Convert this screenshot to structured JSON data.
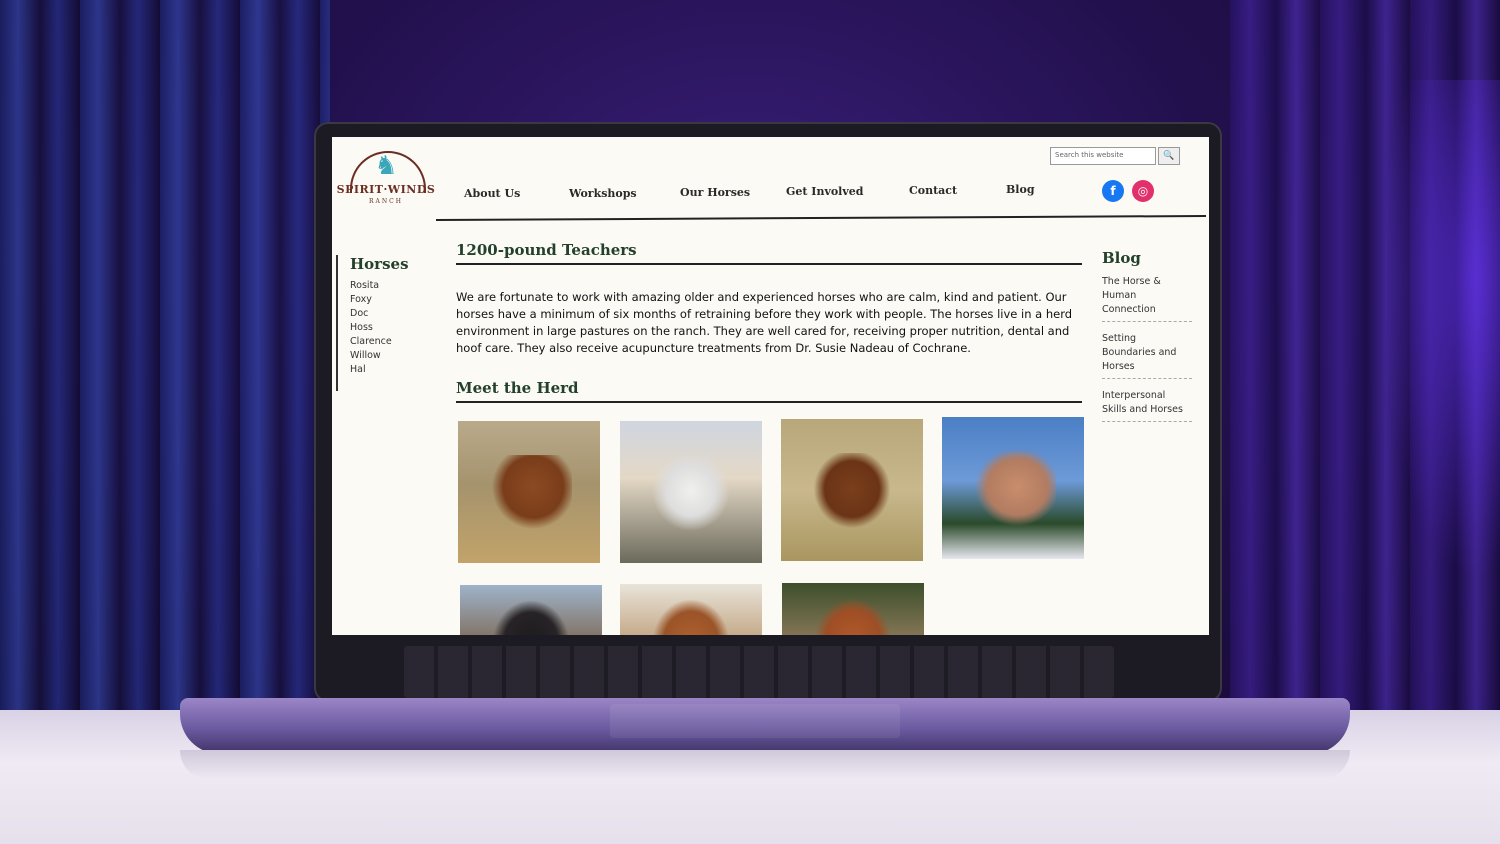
{
  "site": {
    "logo_text": "SPIRIT·WINDS",
    "logo_sub": "RANCH",
    "search_placeholder": "Search this website"
  },
  "nav": {
    "items": [
      "About Us",
      "Workshops",
      "Our Horses",
      "Get Involved",
      "Contact",
      "Blog"
    ]
  },
  "sidebar": {
    "title": "Horses",
    "items": [
      "Rosita",
      "Foxy",
      "Doc",
      "Hoss",
      "Clarence",
      "Willow",
      "Hal"
    ]
  },
  "main": {
    "title": "1200-pound Teachers",
    "intro": "We are fortunate to work with amazing older and experienced horses who are calm, kind and patient. Our horses have a minimum of six months of retraining before they work with people. The horses live in a herd environment in large pastures on the ranch. They are well cared for, receiving proper nutrition, dental and hoof care. They also receive acupuncture treatments from Dr. Susie Nadeau of Cochrane.",
    "herd_title": "Meet the Herd"
  },
  "blog": {
    "title": "Blog",
    "items": [
      "The Horse & Human Connection",
      "Setting Boundaries and Horses",
      "Interpersonal Skills and Horses"
    ]
  },
  "colors": {
    "heading_green": "#23402a",
    "facebook": "#1877f2",
    "instagram": "#e1306c"
  },
  "icons": {
    "search": "search-icon",
    "facebook": "facebook-icon",
    "instagram": "instagram-icon"
  }
}
